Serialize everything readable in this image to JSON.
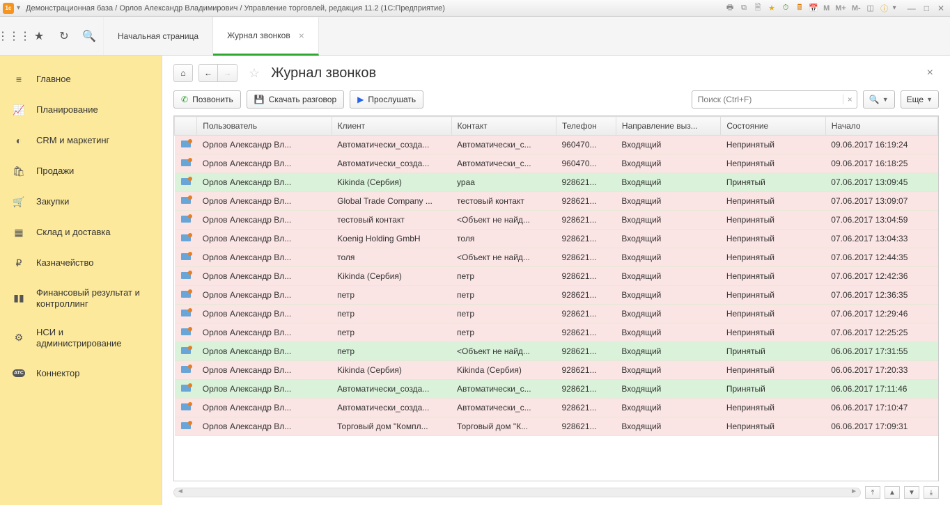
{
  "titlebar": {
    "title": "Демонстрационная база / Орлов Александр Владимирович / Управление торговлей, редакция 11.2  (1С:Предприятие)"
  },
  "toolbar_m": [
    "M",
    "M+",
    "M-"
  ],
  "tabs": {
    "start": "Начальная страница",
    "journal": "Журнал звонков"
  },
  "sidebar": {
    "items": [
      {
        "label": "Главное",
        "icon": "≡"
      },
      {
        "label": "Планирование",
        "icon": "📈"
      },
      {
        "label": "CRM и маркетинг",
        "icon": "◐"
      },
      {
        "label": "Продажи",
        "icon": "🛍"
      },
      {
        "label": "Закупки",
        "icon": "🛒"
      },
      {
        "label": "Склад и доставка",
        "icon": "▦"
      },
      {
        "label": "Казначейство",
        "icon": "₽"
      },
      {
        "label": "Финансовый результат и контроллинг",
        "icon": "▮▮"
      },
      {
        "label": "НСИ и администрирование",
        "icon": "⚙"
      },
      {
        "label": "Коннектор",
        "icon": "ATC"
      }
    ]
  },
  "page": {
    "title": "Журнал звонков"
  },
  "actions": {
    "call": "Позвонить",
    "download": "Скачать разговор",
    "listen": "Прослушать",
    "more": "Еще"
  },
  "search": {
    "placeholder": "Поиск (Ctrl+F)"
  },
  "grid": {
    "headers": {
      "user": "Пользователь",
      "client": "Клиент",
      "contact": "Контакт",
      "phone": "Телефон",
      "direction": "Направление выз...",
      "state": "Состояние",
      "start": "Начало"
    },
    "rows": [
      {
        "user": "Орлов Александр Вл...",
        "client": "Автоматически_созда...",
        "contact": "Автоматически_с...",
        "phone": "960470...",
        "dir": "Входящий",
        "state": "Непринятый",
        "start": "09.06.2017 16:19:24",
        "status": "red"
      },
      {
        "user": "Орлов Александр Вл...",
        "client": "Автоматически_созда...",
        "contact": "Автоматически_с...",
        "phone": "960470...",
        "dir": "Входящий",
        "state": "Непринятый",
        "start": "09.06.2017 16:18:25",
        "status": "red"
      },
      {
        "user": "Орлов Александр Вл...",
        "client": "Kikinda (Сербия)",
        "contact": "ураа",
        "phone": "928621...",
        "dir": "Входящий",
        "state": "Принятый",
        "start": "07.06.2017 13:09:45",
        "status": "green"
      },
      {
        "user": "Орлов Александр Вл...",
        "client": "Global Trade Company ...",
        "contact": "тестовый контакт",
        "phone": "928621...",
        "dir": "Входящий",
        "state": "Непринятый",
        "start": "07.06.2017 13:09:07",
        "status": "red"
      },
      {
        "user": "Орлов Александр Вл...",
        "client": "тестовый контакт",
        "contact": "<Объект не найд...",
        "phone": "928621...",
        "dir": "Входящий",
        "state": "Непринятый",
        "start": "07.06.2017 13:04:59",
        "status": "red"
      },
      {
        "user": "Орлов Александр Вл...",
        "client": "Koenig Holding GmbH",
        "contact": "толя",
        "phone": "928621...",
        "dir": "Входящий",
        "state": "Непринятый",
        "start": "07.06.2017 13:04:33",
        "status": "red"
      },
      {
        "user": "Орлов Александр Вл...",
        "client": "толя",
        "contact": "<Объект не найд...",
        "phone": "928621...",
        "dir": "Входящий",
        "state": "Непринятый",
        "start": "07.06.2017 12:44:35",
        "status": "red"
      },
      {
        "user": "Орлов Александр Вл...",
        "client": "Kikinda (Сербия)",
        "contact": "петр",
        "phone": "928621...",
        "dir": "Входящий",
        "state": "Непринятый",
        "start": "07.06.2017 12:42:36",
        "status": "red"
      },
      {
        "user": "Орлов Александр Вл...",
        "client": "петр",
        "contact": "петр",
        "phone": "928621...",
        "dir": "Входящий",
        "state": "Непринятый",
        "start": "07.06.2017 12:36:35",
        "status": "red"
      },
      {
        "user": "Орлов Александр Вл...",
        "client": "петр",
        "contact": "петр",
        "phone": "928621...",
        "dir": "Входящий",
        "state": "Непринятый",
        "start": "07.06.2017 12:29:46",
        "status": "red"
      },
      {
        "user": "Орлов Александр Вл...",
        "client": "петр",
        "contact": "петр",
        "phone": "928621...",
        "dir": "Входящий",
        "state": "Непринятый",
        "start": "07.06.2017 12:25:25",
        "status": "red"
      },
      {
        "user": "Орлов Александр Вл...",
        "client": "петр",
        "contact": "<Объект не найд...",
        "phone": "928621...",
        "dir": "Входящий",
        "state": "Принятый",
        "start": "06.06.2017 17:31:55",
        "status": "green"
      },
      {
        "user": "Орлов Александр Вл...",
        "client": "Kikinda (Сербия)",
        "contact": "Kikinda (Сербия)",
        "phone": "928621...",
        "dir": "Входящий",
        "state": "Непринятый",
        "start": "06.06.2017 17:20:33",
        "status": "red"
      },
      {
        "user": "Орлов Александр Вл...",
        "client": "Автоматически_созда...",
        "contact": "Автоматически_с...",
        "phone": "928621...",
        "dir": "Входящий",
        "state": "Принятый",
        "start": "06.06.2017 17:11:46",
        "status": "green"
      },
      {
        "user": "Орлов Александр Вл...",
        "client": "Автоматически_созда...",
        "contact": "Автоматически_с...",
        "phone": "928621...",
        "dir": "Входящий",
        "state": "Непринятый",
        "start": "06.06.2017 17:10:47",
        "status": "red"
      },
      {
        "user": "Орлов Александр Вл...",
        "client": "Торговый дом \"Компл...",
        "contact": "Торговый дом \"К...",
        "phone": "928621...",
        "dir": "Входящий",
        "state": "Непринятый",
        "start": "06.06.2017 17:09:31",
        "status": "red"
      }
    ]
  }
}
